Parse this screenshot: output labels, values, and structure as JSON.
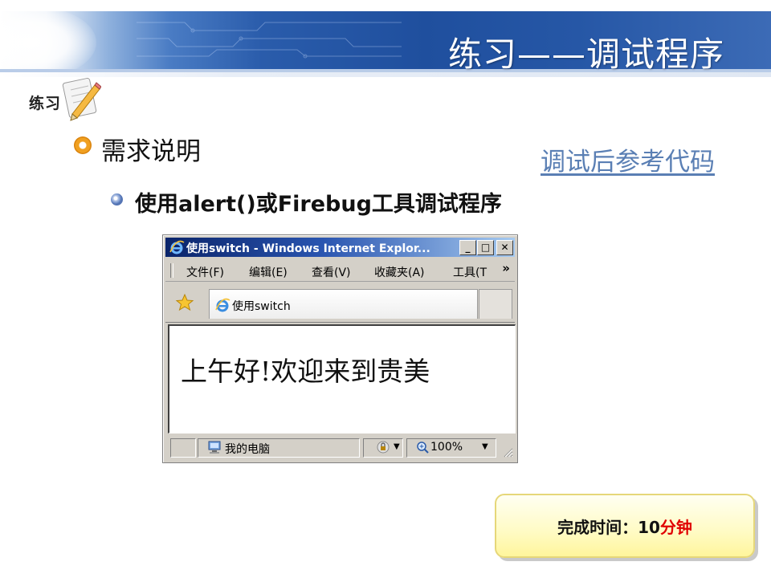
{
  "slide": {
    "title": "练习——调试程序",
    "badge": "练习",
    "heading": "需求说明",
    "reference_link": "调试后参考代码",
    "sub_item": "使用alert()或Firebug工具调试程序"
  },
  "browser": {
    "window_title": "使用switch - Windows Internet Explor...",
    "controls": {
      "minimize": "_",
      "restore": "□",
      "close": "✕"
    },
    "menu": [
      "文件(F)",
      "编辑(E)",
      "查看(V)",
      "收藏夹(A)",
      "工具(T"
    ],
    "menu_overflow": "»",
    "tab_title": "使用switch",
    "page_text": "上午好!欢迎来到贵美",
    "status": {
      "zone": "我的电脑",
      "zoom": "100%"
    }
  },
  "completion": {
    "label": "完成时间：10",
    "unit": "分钟"
  },
  "colors": {
    "banner": "#1f4f9e",
    "link": "#5a7fb4",
    "bullet_orange": "#f0a020",
    "highlight_red": "#e00000",
    "box_fill": "#fffbc4"
  }
}
